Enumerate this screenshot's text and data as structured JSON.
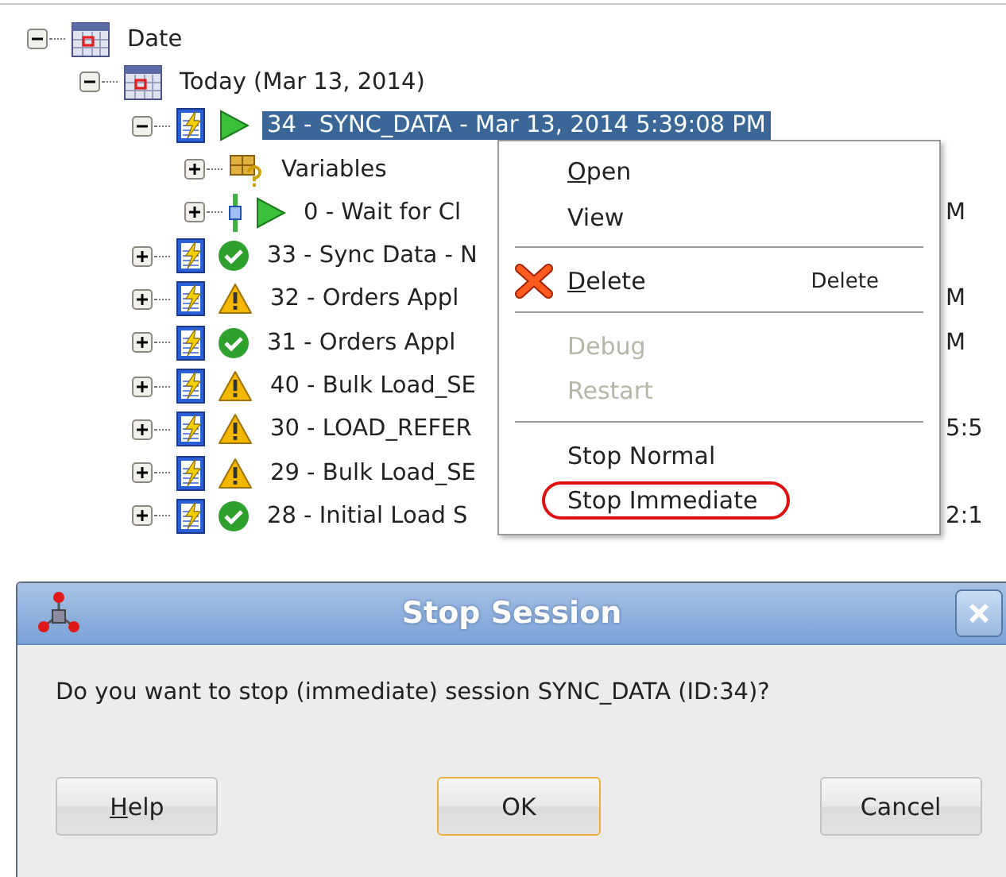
{
  "tree": [
    {
      "label": "Date",
      "kind": "date",
      "expanded": true,
      "selected": false,
      "children": [
        {
          "label": "Today (Mar 13, 2014)",
          "kind": "date",
          "expanded": true,
          "selected": false,
          "children": [
            {
              "label": "34 - SYNC_DATA - Mar 13, 2014 5:39:08 PM",
              "kind": "session-running",
              "expanded": true,
              "selected": true,
              "children": [
                {
                  "label": "Variables",
                  "kind": "variables",
                  "expanded": false,
                  "selected": false
                },
                {
                  "label": "0 - Wait for Cl",
                  "tail": "M",
                  "kind": "step-running",
                  "expanded": false,
                  "selected": false
                }
              ]
            },
            {
              "label": "33 - Sync Data - N",
              "kind": "session-done",
              "expanded": false,
              "selected": false
            },
            {
              "label": "32 - Orders Appl",
              "tail": "M",
              "kind": "session-warning",
              "expanded": false,
              "selected": false
            },
            {
              "label": "31 - Orders Appl",
              "tail": "M",
              "kind": "session-done",
              "expanded": false,
              "selected": false
            },
            {
              "label": "40 - Bulk Load_SE",
              "kind": "session-warning",
              "expanded": false,
              "selected": false
            },
            {
              "label": "30 - LOAD_REFER",
              "tail": "5:5",
              "kind": "session-warning",
              "expanded": false,
              "selected": false
            },
            {
              "label": "29 - Bulk Load_SE",
              "kind": "session-warning",
              "expanded": false,
              "selected": false
            },
            {
              "label": "28 - Initial Load S",
              "tail": "2:1",
              "kind": "session-done",
              "expanded": false,
              "selected": false
            }
          ]
        }
      ]
    }
  ],
  "context_menu": [
    {
      "kind": "item",
      "label": "Open",
      "mnemonic": true,
      "disabled": false
    },
    {
      "kind": "item",
      "label": "View",
      "mnemonic": false,
      "disabled": false
    },
    {
      "kind": "separator"
    },
    {
      "kind": "delete",
      "label": "Delete",
      "mnemonic": true,
      "disabled": false,
      "shortcut": "Delete"
    },
    {
      "kind": "separator"
    },
    {
      "kind": "item",
      "label": "Debug",
      "mnemonic": false,
      "disabled": true
    },
    {
      "kind": "item",
      "label": "Restart",
      "mnemonic": false,
      "disabled": true
    },
    {
      "kind": "separator"
    },
    {
      "kind": "item",
      "label": "Stop Normal",
      "mnemonic": false,
      "disabled": false
    },
    {
      "kind": "item",
      "label": "Stop Immediate",
      "mnemonic": false,
      "disabled": false,
      "circled": true
    }
  ],
  "dialog": {
    "title": "Stop Session",
    "message": "Do you want to stop (immediate) session SYNC_DATA (ID:34)?",
    "buttons": [
      {
        "label": "Help",
        "mnemonic": true,
        "default": false
      },
      {
        "label": "OK",
        "mnemonic": false,
        "default": true
      },
      {
        "label": "Cancel",
        "mnemonic": false,
        "default": false
      }
    ]
  }
}
